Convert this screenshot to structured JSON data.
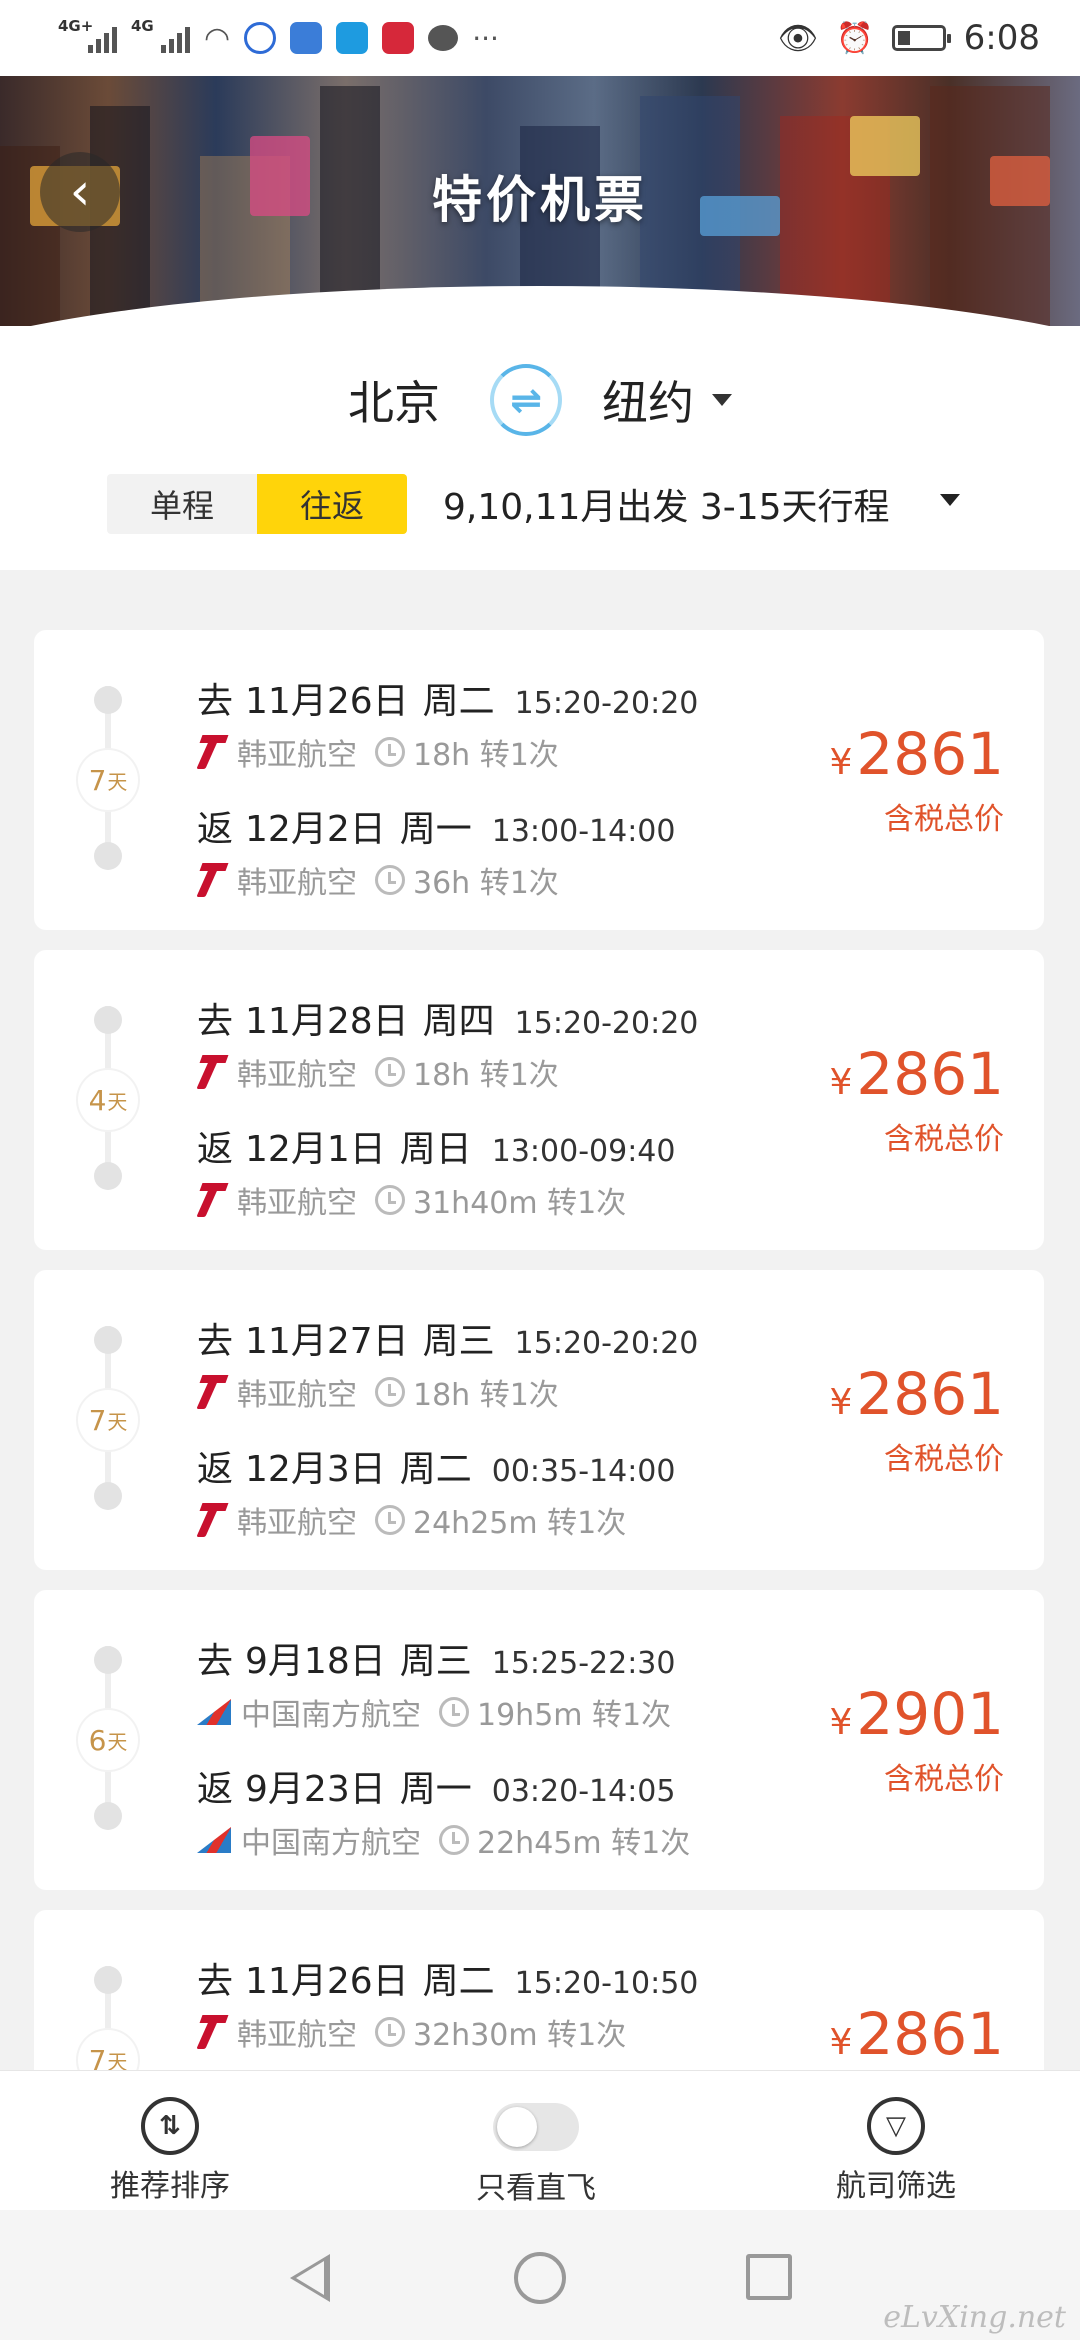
{
  "status_bar": {
    "net1": "4G+",
    "net2": "4G",
    "time": "6:08"
  },
  "header": {
    "title": "特价机票",
    "back_icon": "back-chevron-icon"
  },
  "route": {
    "from": "北京",
    "to": "纽约",
    "swap_icon": "swap-icon"
  },
  "trip_type": {
    "one_way": "单程",
    "round_trip": "往返",
    "selected": "往返",
    "filter": "9,10,11月出发 3-15天行程"
  },
  "flights": [
    {
      "days": "7",
      "days_unit": "天",
      "out": {
        "dir": "去",
        "date": "11月26日",
        "week": "周二",
        "time": "15:20-20:20",
        "airline": "韩亚航空",
        "duration": "18h 转1次",
        "logo": "asiana-logo"
      },
      "ret": {
        "dir": "返",
        "date": "12月2日",
        "week": "周一",
        "time": "13:00-14:00",
        "airline": "韩亚航空",
        "duration": "36h 转1次",
        "logo": "asiana-logo"
      },
      "price": "2861",
      "currency": "¥",
      "price_label": "含税总价"
    },
    {
      "days": "4",
      "days_unit": "天",
      "out": {
        "dir": "去",
        "date": "11月28日",
        "week": "周四",
        "time": "15:20-20:20",
        "airline": "韩亚航空",
        "duration": "18h 转1次",
        "logo": "asiana-logo"
      },
      "ret": {
        "dir": "返",
        "date": "12月1日",
        "week": "周日",
        "time": "13:00-09:40",
        "airline": "韩亚航空",
        "duration": "31h40m 转1次",
        "logo": "asiana-logo"
      },
      "price": "2861",
      "currency": "¥",
      "price_label": "含税总价"
    },
    {
      "days": "7",
      "days_unit": "天",
      "out": {
        "dir": "去",
        "date": "11月27日",
        "week": "周三",
        "time": "15:20-20:20",
        "airline": "韩亚航空",
        "duration": "18h 转1次",
        "logo": "asiana-logo"
      },
      "ret": {
        "dir": "返",
        "date": "12月3日",
        "week": "周二",
        "time": "00:35-14:00",
        "airline": "韩亚航空",
        "duration": "24h25m 转1次",
        "logo": "asiana-logo"
      },
      "price": "2861",
      "currency": "¥",
      "price_label": "含税总价"
    },
    {
      "days": "6",
      "days_unit": "天",
      "out": {
        "dir": "去",
        "date": "9月18日",
        "week": "周三",
        "time": "15:25-22:30",
        "airline": "中国南方航空",
        "duration": "19h5m 转1次",
        "logo": "china-southern-logo"
      },
      "ret": {
        "dir": "返",
        "date": "9月23日",
        "week": "周一",
        "time": "03:20-14:05",
        "airline": "中国南方航空",
        "duration": "22h45m 转1次",
        "logo": "china-southern-logo"
      },
      "price": "2901",
      "currency": "¥",
      "price_label": "含税总价"
    },
    {
      "days": "7",
      "days_unit": "天",
      "out": {
        "dir": "去",
        "date": "11月26日",
        "week": "周二",
        "time": "15:20-10:50",
        "airline": "韩亚航空",
        "duration": "32h30m 转1次",
        "logo": "asiana-logo"
      },
      "price": "2861",
      "currency": "¥"
    }
  ],
  "bottom_bar": {
    "sort": "推荐排序",
    "direct_only": "只看直飞",
    "airline_filter": "航司筛选"
  },
  "watermark": "eLvXing.net"
}
